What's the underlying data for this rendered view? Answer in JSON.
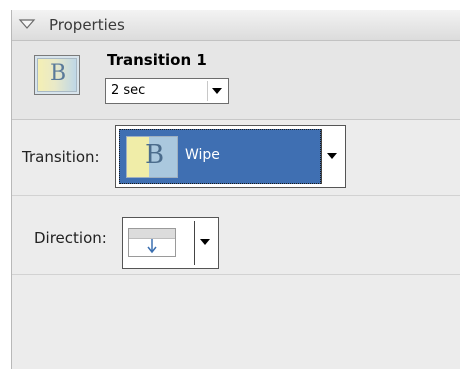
{
  "panel": {
    "title": "Properties",
    "clip": {
      "name": "Transition 1",
      "duration": "2 sec",
      "thumbnail_glyph": "B"
    },
    "transition": {
      "label": "Transition:",
      "value": "Wipe",
      "glyph": "B",
      "highlight_color": "#3f6fb2"
    },
    "direction": {
      "label": "Direction:",
      "icon": "arrow-down-icon"
    }
  }
}
